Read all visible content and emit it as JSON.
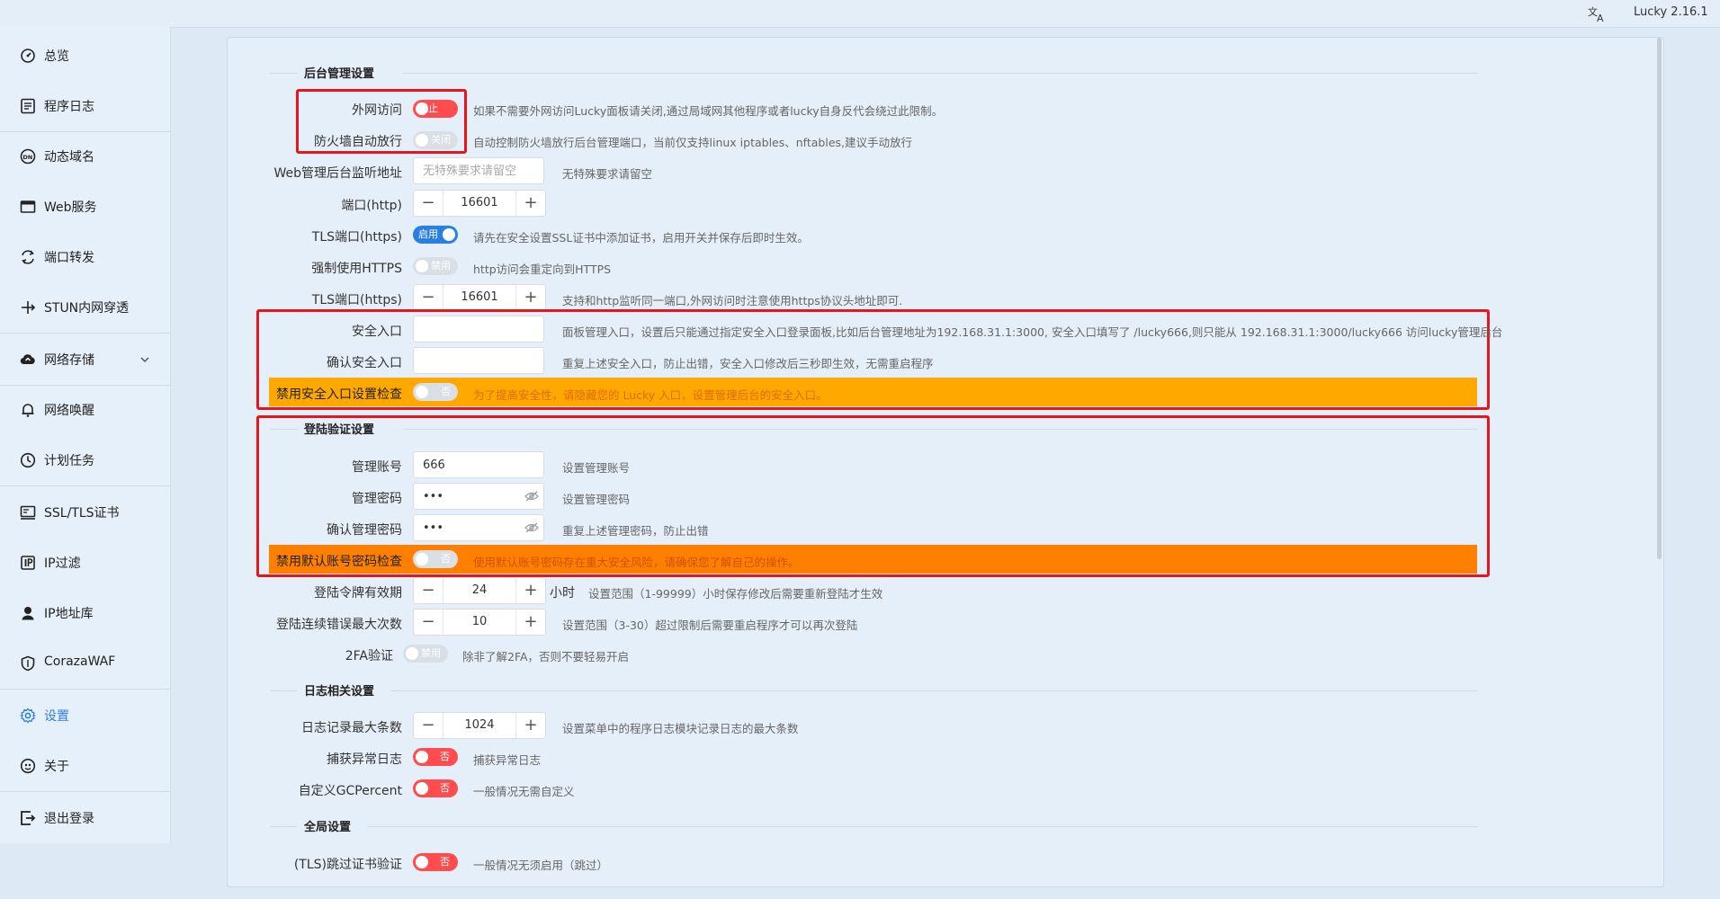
{
  "app": {
    "version": "Lucky 2.16.1",
    "lang_icon": "translate-icon"
  },
  "sidebar": {
    "items": [
      {
        "label": "总览",
        "icon": "dashboard-icon"
      },
      {
        "label": "程序日志",
        "icon": "log-icon"
      },
      {
        "label": "动态域名",
        "icon": "dns-icon"
      },
      {
        "label": "Web服务",
        "icon": "web-icon"
      },
      {
        "label": "端口转发",
        "icon": "port-forward-icon"
      },
      {
        "label": "STUN内网穿透",
        "icon": "stun-icon"
      },
      {
        "label": "网络存储",
        "icon": "cloud-storage-icon"
      },
      {
        "label": "网络唤醒",
        "icon": "bell-icon"
      },
      {
        "label": "计划任务",
        "icon": "clock-icon"
      },
      {
        "label": "SSL/TLS证书",
        "icon": "certificate-icon"
      },
      {
        "label": "IP过滤",
        "icon": "filter-icon"
      },
      {
        "label": "IP地址库",
        "icon": "location-icon"
      },
      {
        "label": "CorazaWAF",
        "icon": "shield-icon"
      },
      {
        "label": "设置",
        "icon": "gear-icon"
      },
      {
        "label": "关于",
        "icon": "about-icon"
      },
      {
        "label": "退出登录",
        "icon": "logout-icon"
      }
    ],
    "active": "设置"
  },
  "sections": {
    "admin": "后台管理设置",
    "login": "登陆验证设置",
    "log": "日志相关设置",
    "global": "全局设置"
  },
  "rows": {
    "wan_access": {
      "label": "外网访问",
      "switch": "禁止",
      "hint": "如果不需要外网访问Lucky面板请关闭,通过局域网其他程序或者lucky自身反代会绕过此限制。"
    },
    "firewall": {
      "label": "防火墙自动放行",
      "switch": "关闭",
      "hint": "自动控制防火墙放行后台管理端口，当前仅支持linux iptables、nftables,建议手动放行"
    },
    "listen_addr": {
      "label": "Web管理后台监听地址",
      "placeholder": "无特殊要求请留空",
      "hint": "无特殊要求请留空"
    },
    "http_port": {
      "label": "端口(http)",
      "value": "16601"
    },
    "tls_port_switch": {
      "label": "TLS端口(https)",
      "switch": "启用",
      "hint": "请先在安全设置SSL证书中添加证书，启用开关并保存后即时生效。"
    },
    "force_https": {
      "label": "强制使用HTTPS",
      "switch": "禁用",
      "hint": "http访问会重定向到HTTPS"
    },
    "tls_port": {
      "label": "TLS端口(https)",
      "value": "16601",
      "hint": "支持和http监听同一端口,外网访问时注意使用https协议头地址即可."
    },
    "safe_entry": {
      "label": "安全入口",
      "value": "",
      "hint": "面板管理入口，设置后只能通过指定安全入口登录面板,比如后台管理地址为192.168.31.1:3000, 安全入口填写了 /lucky666,则只能从 192.168.31.1:3000/lucky666 访问lucky管理后台"
    },
    "confirm_entry": {
      "label": "确认安全入口",
      "value": "",
      "hint": "重复上述安全入口，防止出错，安全入口修改后三秒即生效，无需重启程序"
    },
    "disable_entry_check": {
      "label": "禁用安全入口设置检查",
      "switch": "否",
      "hint": "为了提高安全性，请隐藏您的 Lucky 入口，设置管理后台的安全入口。"
    },
    "admin_account": {
      "label": "管理账号",
      "value": "666",
      "hint": "设置管理账号"
    },
    "admin_password": {
      "label": "管理密码",
      "value": "•••",
      "hint": "设置管理密码"
    },
    "confirm_password": {
      "label": "确认管理密码",
      "value": "•••",
      "hint": "重复上述管理密码，防止出错"
    },
    "disable_default_check": {
      "label": "禁用默认账号密码检查",
      "switch": "否",
      "hint": "使用默认账号密码存在重大安全风险，请确保您了解自己的操作。"
    },
    "token_expiry": {
      "label": "登陆令牌有效期",
      "value": "24",
      "unit": "小时",
      "hint": "设置范围（1-99999）小时保存修改后需要重新登陆才生效"
    },
    "max_errors": {
      "label": "登陆连续错误最大次数",
      "value": "10",
      "hint": "设置范围（3-30）超过限制后需要重启程序才可以再次登陆"
    },
    "twofa": {
      "label": "2FA验证",
      "switch": "禁用",
      "hint": "除非了解2FA，否则不要轻易开启"
    },
    "log_max": {
      "label": "日志记录最大条数",
      "value": "1024",
      "hint": "设置菜单中的程序日志模块记录日志的最大条数"
    },
    "catch_err": {
      "label": "捕获异常日志",
      "switch": "否",
      "hint": "捕获异常日志"
    },
    "gc": {
      "label": "自定义GCPercent",
      "switch": "否",
      "hint": "一般情况无需自定义"
    },
    "tls_skip": {
      "label": "(TLS)跳过证书验证",
      "switch": "否",
      "hint": "一般情况无须启用（跳过）"
    }
  },
  "colors": {
    "accent": "#2f7fe0",
    "danger": "#ff4d4f",
    "warn_yellow": "#ffa800",
    "warn_orange": "#ff8000",
    "highlight_border": "#e8161b"
  }
}
